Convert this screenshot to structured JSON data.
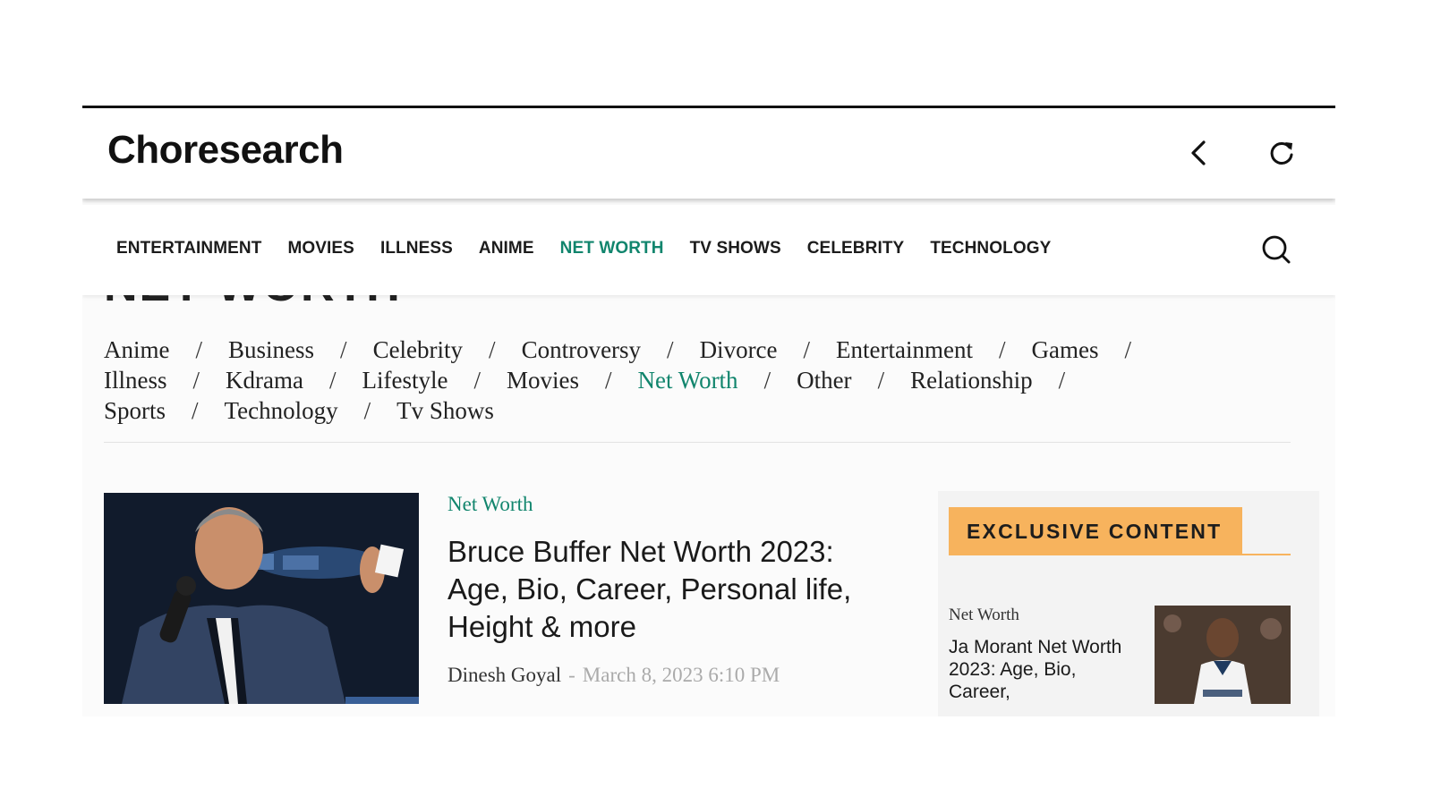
{
  "header": {
    "logo": "Choresearch",
    "back_icon": "chevron-left-icon",
    "refresh_icon": "refresh-icon"
  },
  "nav": {
    "items": [
      {
        "label": "ENTERTAINMENT"
      },
      {
        "label": "MOVIES"
      },
      {
        "label": "ILLNESS"
      },
      {
        "label": "ANIME"
      },
      {
        "label": "NET WORTH",
        "active": true
      },
      {
        "label": "TV SHOWS"
      },
      {
        "label": "CELEBRITY"
      },
      {
        "label": "TECHNOLOGY"
      }
    ],
    "search_icon": "search-icon",
    "accent_color": "#11856d"
  },
  "page_title": "NET WORTH",
  "categories": [
    {
      "label": "Anime"
    },
    {
      "label": "Business"
    },
    {
      "label": "Celebrity"
    },
    {
      "label": "Controversy"
    },
    {
      "label": "Divorce"
    },
    {
      "label": "Entertainment"
    },
    {
      "label": "Games"
    },
    {
      "label": "Illness"
    },
    {
      "label": "Kdrama"
    },
    {
      "label": "Lifestyle"
    },
    {
      "label": "Movies"
    },
    {
      "label": "Net Worth",
      "active": true
    },
    {
      "label": "Other"
    },
    {
      "label": "Relationship"
    },
    {
      "label": "Sports"
    },
    {
      "label": "Technology"
    },
    {
      "label": "Tv Shows"
    }
  ],
  "category_separator": "/",
  "article": {
    "category": "Net Worth",
    "title": "Bruce Buffer Net Worth 2023: Age, Bio, Career, Personal life, Height & more",
    "author": "Dinesh Goyal",
    "separator": "-",
    "date": "March 8, 2023 6:10 PM"
  },
  "sidebar": {
    "badge": "EXCLUSIVE CONTENT",
    "badge_color": "#f7b35d",
    "item": {
      "category": "Net Worth",
      "title": "Ja Morant Net Worth 2023: Age, Bio, Career,"
    }
  }
}
